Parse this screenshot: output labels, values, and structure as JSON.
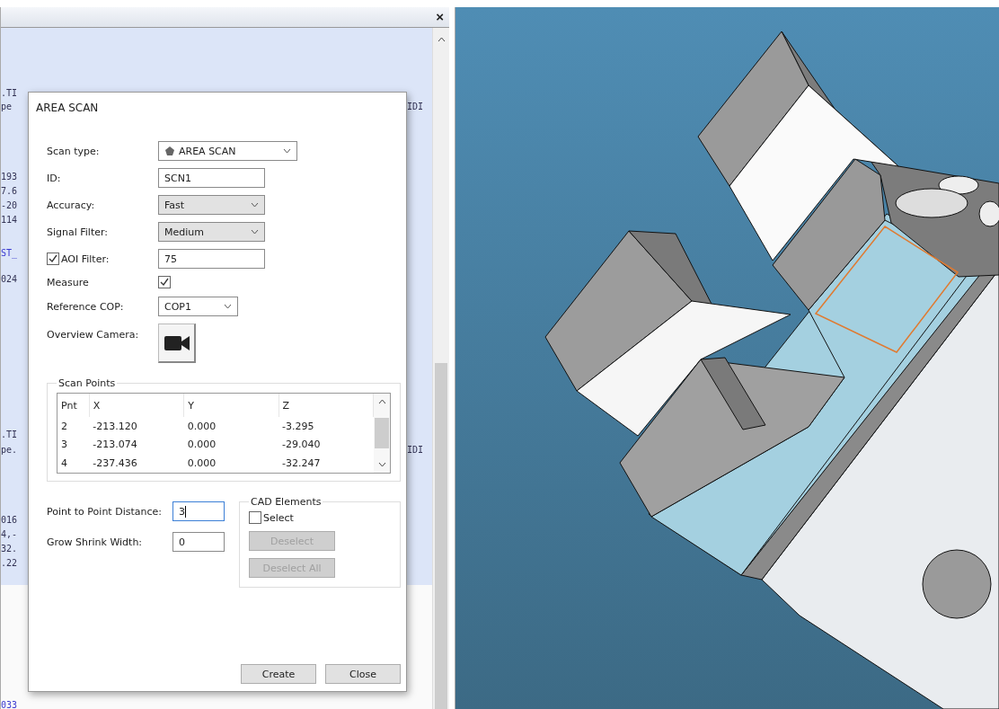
{
  "log_panel": {
    "close": "×",
    "left_fragments": [
      {
        "text": ".TI",
        "kind": "plain"
      },
      {
        "text": "pe",
        "kind": "plain"
      },
      {
        "text": "193",
        "kind": "plain"
      },
      {
        "text": "7.6",
        "kind": "plain"
      },
      {
        "text": "-20",
        "kind": "plain"
      },
      {
        "text": "114",
        "kind": "plain"
      },
      {
        "text": "ST_",
        "kind": "keyword"
      },
      {
        "text": "024",
        "kind": "plain"
      },
      {
        "text": ".TI",
        "kind": "plain"
      },
      {
        "text": "pe.",
        "kind": "plain"
      },
      {
        "text": "016",
        "kind": "plain"
      },
      {
        "text": "4,-",
        "kind": "plain"
      },
      {
        "text": "32.",
        "kind": "plain"
      },
      {
        "text": ".22",
        "kind": "plain"
      },
      {
        "text": "033",
        "kind": "keyword"
      }
    ],
    "right_fragments": [
      {
        "text": "IDI",
        "kind": "plain"
      },
      {
        "text": "IDI",
        "kind": "plain"
      }
    ]
  },
  "dialog": {
    "title": "AREA SCAN",
    "fields": [
      {
        "kind": "select",
        "label": "Scan type:",
        "value": "AREA SCAN"
      },
      {
        "kind": "input",
        "label": "ID:",
        "value": "SCN1"
      },
      {
        "kind": "combo",
        "label": "Accuracy:",
        "value": "Fast"
      },
      {
        "kind": "combo",
        "label": "Signal Filter:",
        "value": "Medium"
      },
      {
        "kind": "check_input",
        "label": "AOI Filter:",
        "checked": true,
        "value": "75"
      },
      {
        "kind": "check",
        "label": "Measure",
        "checked": true
      },
      {
        "kind": "select",
        "label": "Reference COP:",
        "value": "COP1"
      },
      {
        "kind": "camera",
        "label": "Overview Camera:"
      }
    ],
    "scan_points": {
      "title": "Scan Points",
      "columns": [
        "Pnt",
        "X",
        "Y",
        "Z"
      ],
      "rows": [
        [
          "2",
          "-213.120",
          "0.000",
          "-3.295"
        ],
        [
          "3",
          "-213.074",
          "0.000",
          "-29.040"
        ],
        [
          "4",
          "-237.436",
          "0.000",
          "-32.247"
        ]
      ]
    },
    "distance_fields": [
      {
        "label": "Point to Point Distance:",
        "value": "3",
        "focused": true
      },
      {
        "label": "Grow Shrink Width:",
        "value": "0",
        "focused": false
      }
    ],
    "cad_elements": {
      "title": "CAD Elements",
      "select": {
        "label": "Select",
        "checked": false
      },
      "buttons": [
        {
          "label": "Deselect",
          "disabled": true
        },
        {
          "label": "Deselect All",
          "disabled": true
        }
      ]
    },
    "buttons": [
      "Create",
      "Close"
    ]
  }
}
